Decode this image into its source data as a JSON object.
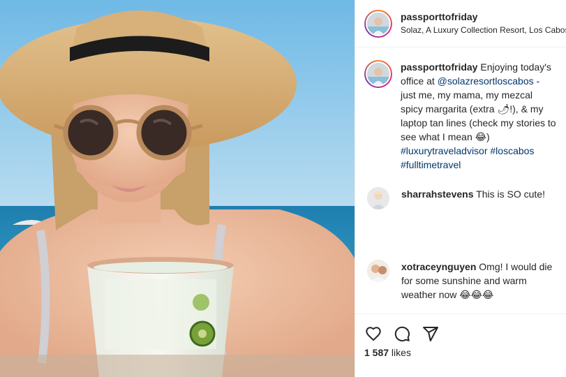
{
  "post": {
    "username": "passporttofriday",
    "location": "Solaz, A Luxury Collection Resort, Los Cabos",
    "photo_icon": "beach-selfie-photo"
  },
  "caption": {
    "username": "passporttofriday",
    "text_1": " Enjoying today's office at ",
    "mention": "@solazresortloscabos",
    "text_2": " - just me, my mama, my mezcal spicy margarita (extra 🌶!), & my laptop tan lines (check my stories to see what I mean 😂) ",
    "hashtag_1": "#luxurytraveladvisor",
    "hashtag_2": "#loscabos",
    "hashtag_3": "#fulltimetravel"
  },
  "comments": [
    {
      "username": "sharrahstevens",
      "text": " This is SO cute!"
    },
    {
      "username": "xotraceynguyen",
      "text": " Omg! I would die for some sunshine and warm weather now 😂😂😂"
    }
  ],
  "actions": {
    "like_icon": "heart-icon",
    "comment_icon": "comment-icon",
    "share_icon": "share-icon"
  },
  "likes": {
    "count": "1 587",
    "label": " likes"
  }
}
